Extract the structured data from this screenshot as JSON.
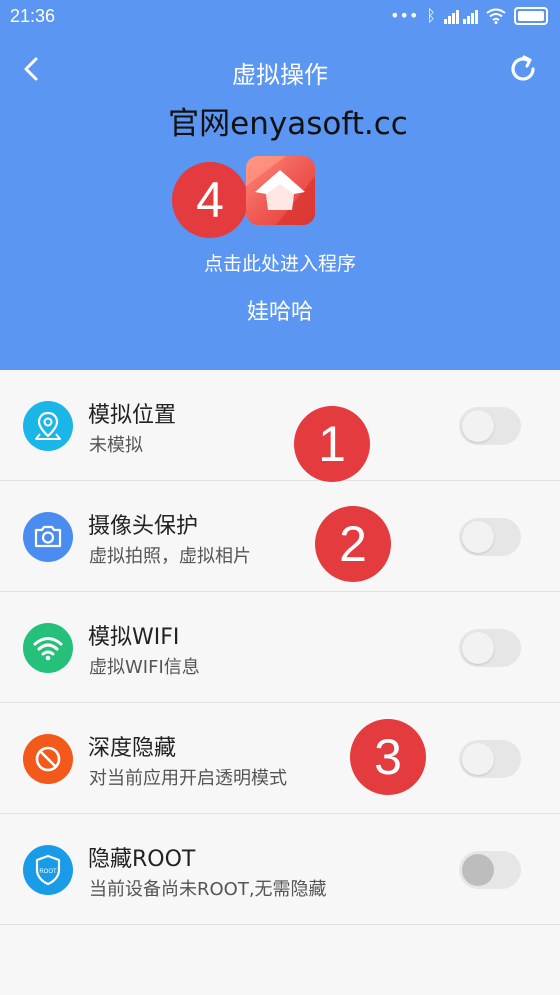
{
  "status_bar": {
    "time": "21:36",
    "signal_icon": "signal-icon",
    "wifi_icon": "wifi-icon",
    "battery_icon": "battery-icon"
  },
  "header": {
    "title": "虚拟操作",
    "website": "官网enyasoft.cc",
    "enter_text": "点击此处进入程序",
    "app_name": "娃哈哈",
    "back_icon": "back-arrow-icon",
    "refresh_icon": "refresh-icon",
    "color": "#5b96f2"
  },
  "badges": [
    "4",
    "1",
    "2",
    "3"
  ],
  "settings": [
    {
      "title": "模拟位置",
      "subtitle": "未模拟",
      "icon": "location-pin-icon",
      "icon_color": "#1ab6e8",
      "enabled": false
    },
    {
      "title": "摄像头保护",
      "subtitle": "虚拟拍照，虚拟相片",
      "icon": "camera-icon",
      "icon_color": "#4a8cf0",
      "enabled": false
    },
    {
      "title": "模拟WIFI",
      "subtitle": "虚拟WIFI信息",
      "icon": "wifi-icon",
      "icon_color": "#25c07a",
      "enabled": false
    },
    {
      "title": "深度隐藏",
      "subtitle": "对当前应用开启透明模式",
      "icon": "forbidden-icon",
      "icon_color": "#f2591b",
      "enabled": false
    },
    {
      "title": "隐藏ROOT",
      "subtitle": "当前设备尚未ROOT,无需隐藏",
      "icon": "root-shield-icon",
      "icon_color": "#1a9be8",
      "enabled": false
    }
  ]
}
